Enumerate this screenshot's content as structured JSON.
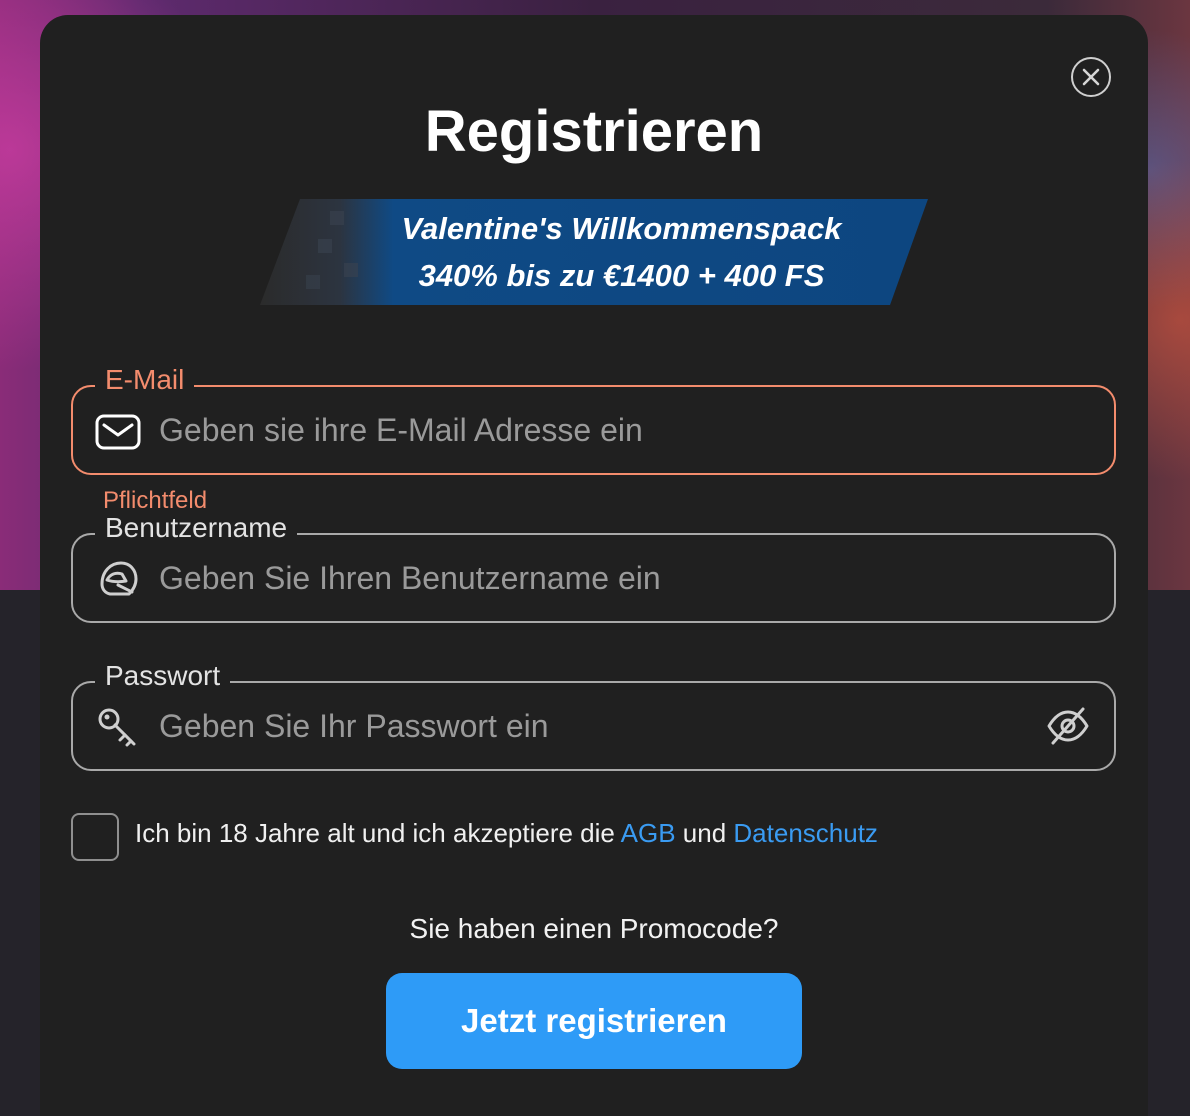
{
  "modal": {
    "title": "Registrieren",
    "close_icon": "close-icon"
  },
  "banner": {
    "line1": "Valentine's Willkommenspack",
    "line2": "340% bis zu €1400 + 400 FS"
  },
  "email": {
    "label": "E-Mail",
    "placeholder": "Geben sie ihre E-Mail Adresse ein",
    "value": "",
    "icon": "envelope-icon",
    "error": "Pflichtfeld"
  },
  "username": {
    "label": "Benutzername",
    "placeholder": "Geben Sie Ihren Benutzername ein",
    "value": "",
    "icon": "helmet-icon"
  },
  "password": {
    "label": "Passwort",
    "placeholder": "Geben Sie Ihr Passwort ein",
    "value": "",
    "icon": "key-icon",
    "toggle_icon": "eye-off-icon"
  },
  "terms": {
    "checked": false,
    "text_before": "Ich bin 18 Jahre alt und ich akzeptiere die ",
    "agb_link": "AGB",
    "text_middle": " und ",
    "privacy_link": "Datenschutz"
  },
  "promo": {
    "text": "Sie haben einen Promocode?"
  },
  "submit": {
    "label": "Jetzt registrieren"
  },
  "colors": {
    "modal_bg": "#202020",
    "error": "#f38c6d",
    "link": "#3a9bf2",
    "button": "#2e9bf7",
    "banner_blue": "#0f4a85"
  }
}
